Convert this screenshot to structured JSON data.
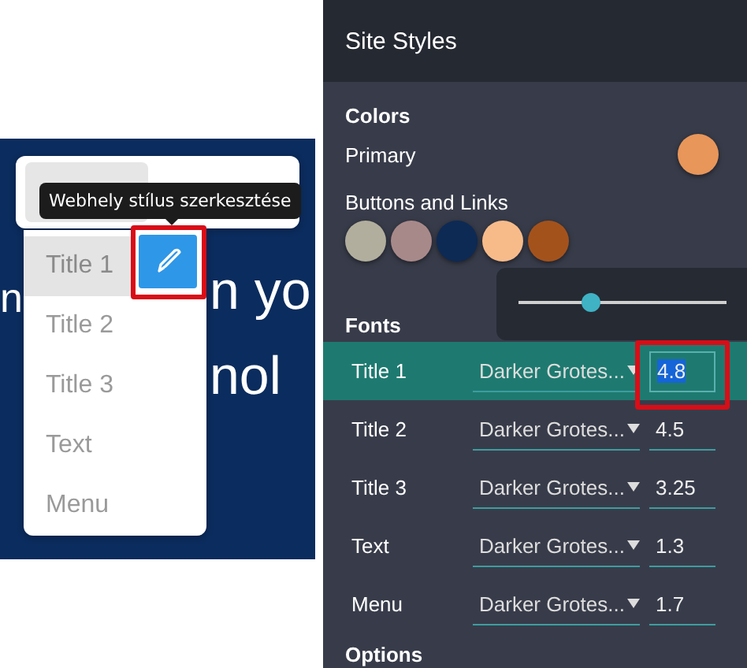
{
  "background_text": [
    "n",
    "n yo",
    "nol"
  ],
  "tooltip": {
    "text": "Webhely stílus szerkesztése"
  },
  "style_menu": {
    "items": [
      {
        "label": "Title 1",
        "selected": true
      },
      {
        "label": "Title 2",
        "selected": false
      },
      {
        "label": "Title 3",
        "selected": false
      },
      {
        "label": "Text",
        "selected": false
      },
      {
        "label": "Menu",
        "selected": false
      }
    ]
  },
  "panel": {
    "title": "Site Styles",
    "colors": {
      "heading": "Colors",
      "primary_label": "Primary",
      "primary": {
        "color": "#e8965a"
      },
      "links_label": "Buttons and Links",
      "swatches": [
        {
          "color": "#b1ae9e"
        },
        {
          "color": "#a8898a"
        },
        {
          "color": "#0d2a55"
        },
        {
          "color": "#f7bb8a"
        },
        {
          "color": "#a4521c"
        }
      ]
    },
    "size_popup": {
      "level": 0.35
    },
    "fonts": {
      "heading": "Fonts",
      "rows": [
        {
          "label": "Title 1",
          "font": "Darker Grotes...",
          "size": "4.8",
          "selected": true
        },
        {
          "label": "Title 2",
          "font": "Darker Grotes...",
          "size": "4.5",
          "selected": false
        },
        {
          "label": "Title 3",
          "font": "Darker Grotes...",
          "size": "3.25",
          "selected": false
        },
        {
          "label": "Text",
          "font": "Darker Grotes...",
          "size": "1.3",
          "selected": false
        },
        {
          "label": "Menu",
          "font": "Darker Grotes...",
          "size": "1.7",
          "selected": false
        }
      ]
    },
    "options_heading": "Options"
  }
}
